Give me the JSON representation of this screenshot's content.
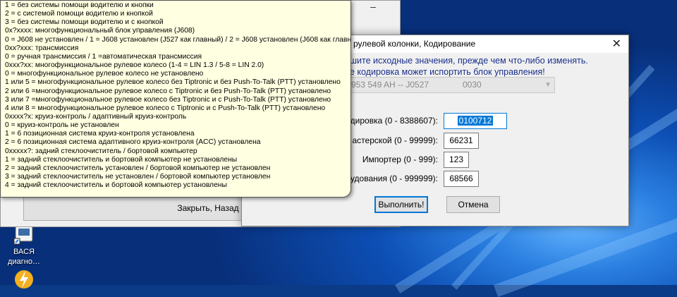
{
  "background_window": {
    "minimize_symbol": "–",
    "close_button_label": "Закрыть, Назад"
  },
  "dialog": {
    "title": "а рулевой колонки,  Кодирование",
    "close_symbol": "✕",
    "warning_line1": "ишите исходные значения, прежде чем что-либо изменять.",
    "warning_line2": "ое кодировка может испортить блок управления!",
    "combo_text": "953 549 AH -- J0527",
    "combo_code": "0030",
    "fields": [
      {
        "label": "дировка (0 - 8388607):",
        "value": "0100712"
      },
      {
        "label": "астерской (0 - 99999):",
        "value": "66231"
      },
      {
        "label": "Импортер (0 - 999):",
        "value": "123"
      },
      {
        "label": "удования (0 - 999999):",
        "value": "68566"
      }
    ],
    "execute_label": "Выполнить!",
    "cancel_label": "Отмена"
  },
  "tooltip_lines": [
    "1 = без системы помощи водителю и кнопки",
    "2 = с системой помощи водителю и кнопкой",
    "3 = без системы помощи водителю и с кнопкой",
    "0x?xxxx: многофункциональный блок управления (J608)",
    "0 = J608 не установлен / 1 = J608 установлен (J527 как главный) / 2 = J608 установлен (J608 как главный)",
    "0xx?xxx: трансмиссия",
    "0 = ручная трансмиссия / 1 =автоматическая трансмиссия",
    "0xxx?xx: многофункциональное рулевое колесо (1-4 = LIN 1.3 / 5-8 = LIN 2.0)",
    "0 = многофункциональное рулевое колесо не установлено",
    "1 или 5 = многофункциональное рулевое колесо без Tiptronic и без Push-To-Talk (PTT) установлено",
    "2 или 6 =многофункциональное рулевое колесо с Tiptronic и без Push-To-Talk (PTT) установлено",
    "3 или 7 =многофункциональное рулевое колесо без Tiptronic и с Push-To-Talk (PTT) установлено",
    "4 или 8 = многофункциональное рулевое колесо с Tiptronic и с Push-To-Talk (PTT) установлено",
    "0xxxx?x: круиз-контроль / адаптивный круиз-контроль",
    "0 = круиз-контроль не установлен",
    "1 = 6 позиционная система круиз-контроля установлена",
    "2 = 6 позиционная система адаптивного круиз-контроля (ACC) установлена",
    "0xxxxx?: задний стеклоочиститель / бортовой компьютер",
    "1 = задний стеклоочиститель и бортовой компьютер не установлены",
    "2 = задний стеклоочиститель установлен / бортовой компьютер не установлен",
    "3 = задний стеклоочиститель не установлен / бортовой компьютер установлен",
    "4 = задний стеклоочиститель и бортовой компьютер установлены"
  ],
  "desktop_icons": [
    {
      "label_line1": "ВАСЯ",
      "label_line2": "диагно…"
    }
  ]
}
